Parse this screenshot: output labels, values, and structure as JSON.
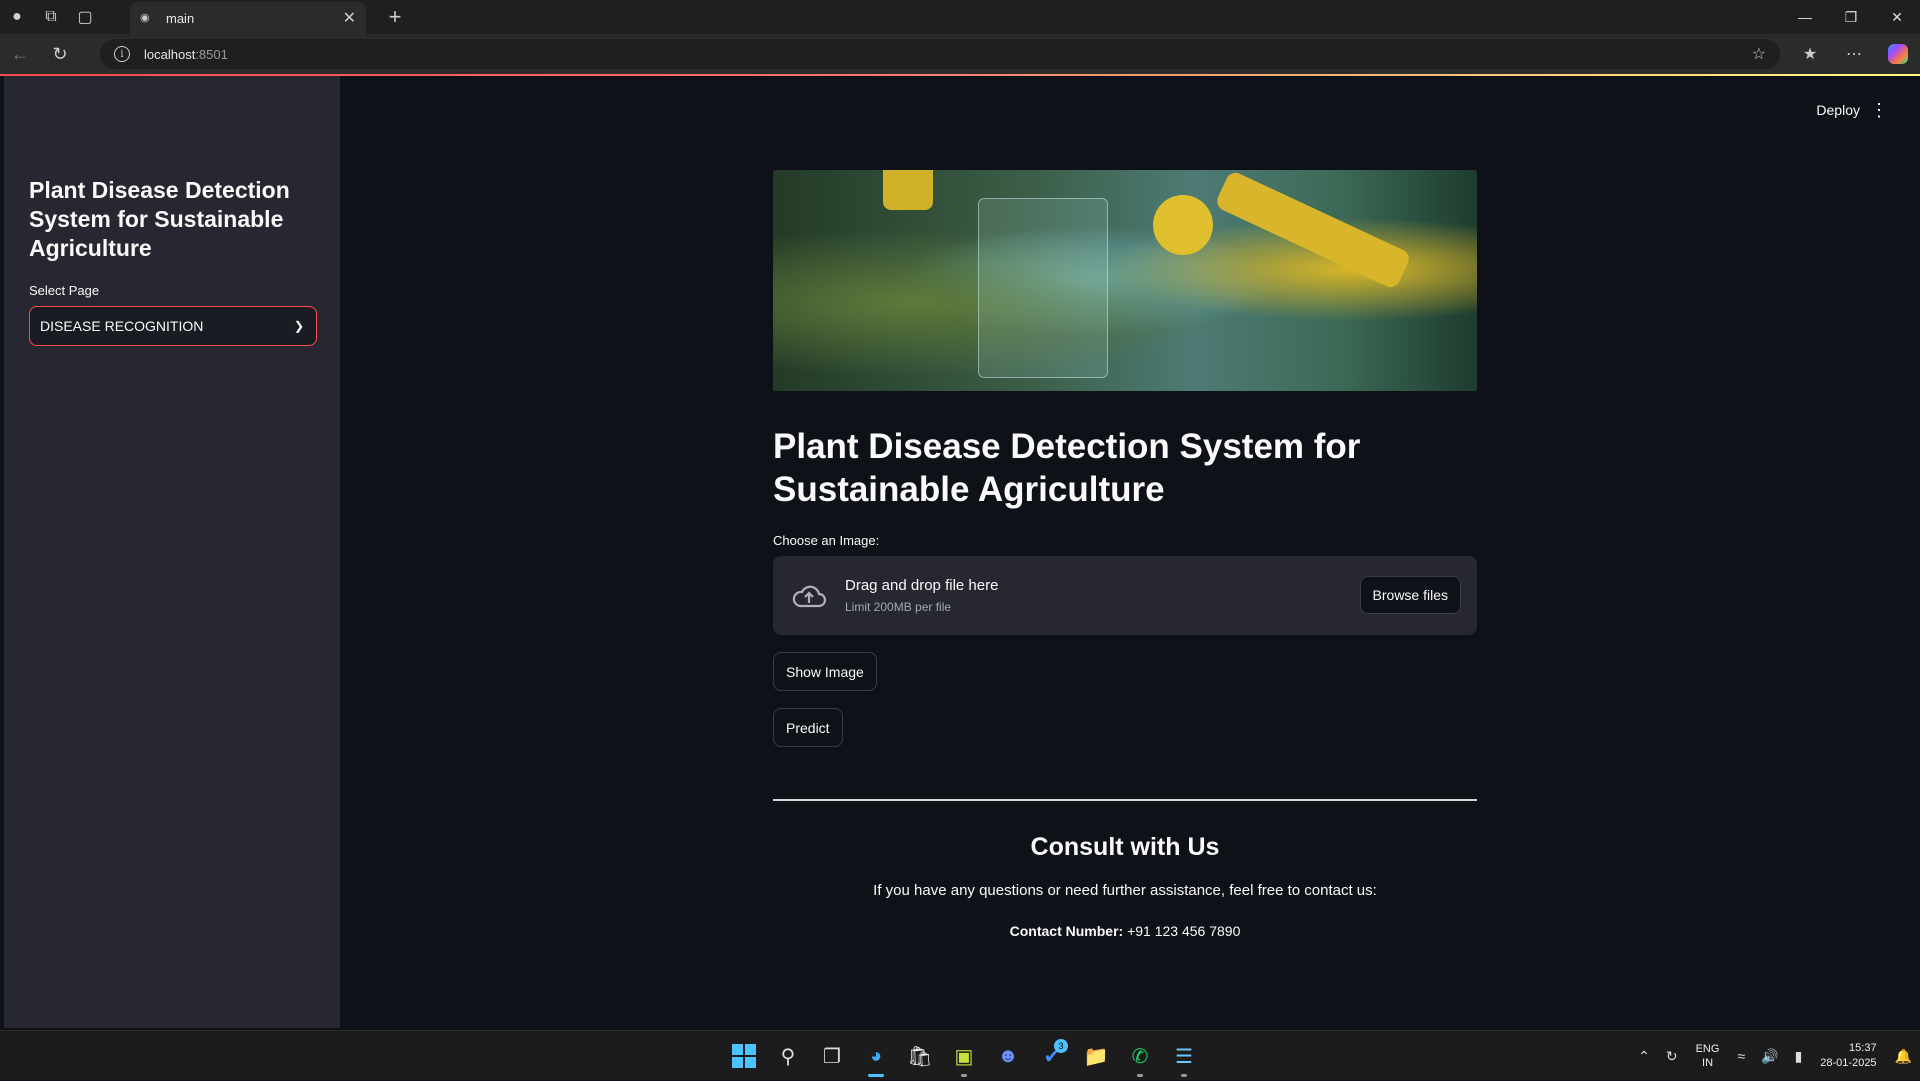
{
  "browser": {
    "tab_title": "main",
    "url_host": "localhost",
    "url_port": ":8501"
  },
  "sidebar": {
    "title": "Plant Disease Detection System for Sustainable Agriculture",
    "select_label": "Select Page",
    "select_value": "DISEASE RECOGNITION"
  },
  "header": {
    "deploy_label": "Deploy"
  },
  "main": {
    "title": "Plant Disease Detection System for Sustainable Agriculture",
    "upload_label": "Choose an Image:",
    "dropzone_text": "Drag and drop file here",
    "dropzone_limit": "Limit 200MB per file",
    "browse_label": "Browse files",
    "show_image_label": "Show Image",
    "predict_label": "Predict",
    "consult_title": "Consult with Us",
    "consult_text": "If you have any questions or need further assistance, feel free to contact us:",
    "contact_label": "Contact Number:",
    "contact_value": " +91 123 456 7890"
  },
  "taskbar": {
    "lang_1": "ENG",
    "lang_2": "IN",
    "time": "15:37",
    "date": "28-01-2025",
    "todo_badge": "3"
  },
  "colors": {
    "accent": "#ff4b4b",
    "background": "#0e1117",
    "sidebar": "#262730"
  }
}
